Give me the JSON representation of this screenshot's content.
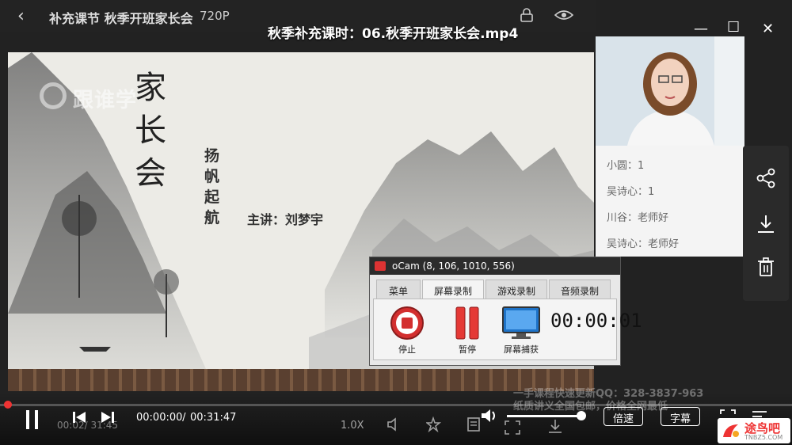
{
  "player": {
    "back_icon": "chevron-left-icon",
    "lesson_title": "补充课节 秋季开班家长会",
    "quality": "720P",
    "window_title": "秋季补充课时：06.秋季开班家长会.mp4",
    "logo_text": "跟谁学"
  },
  "slide": {
    "title_chars": [
      "家",
      "长",
      "会"
    ],
    "subtitle_chars": [
      "扬",
      "帆",
      "起",
      "航"
    ],
    "speaker": "主讲：刘梦宇"
  },
  "chat": {
    "messages": [
      {
        "text": "小圆：1"
      },
      {
        "text": "吴诗心：1"
      },
      {
        "text": "川谷：老师好"
      },
      {
        "text": "吴诗心：老师好"
      }
    ]
  },
  "ocam": {
    "title": "oCam (8, 106, 1010, 556)",
    "tabs": [
      "菜单",
      "屏幕录制",
      "游戏录制",
      "音频录制"
    ],
    "active_tab": 1,
    "buttons": {
      "stop": "停止",
      "pause": "暂停",
      "capture": "屏幕捕获"
    },
    "timer": "00:00:01"
  },
  "controls": {
    "current_time": "00:00:00",
    "time_sep": " / ",
    "total_time": "00:31:47",
    "bg_time": "00:02/ 31:45",
    "speed": "1.0X",
    "speed_btn": "倍速",
    "subtitle_btn": "字幕",
    "progress": 0.0
  },
  "watermark": {
    "line1": "一手课程快速更新QQ：328-3837-963",
    "line2": "纸质讲义全国包邮，价格全网最低"
  },
  "brand": {
    "text": "途鸟吧",
    "sub": "TNBZ5.COM"
  },
  "colors": {
    "accent": "#e33333",
    "ocam_stop": "#d32f2f",
    "ocam_pause": "#e53935",
    "ocam_capture": "#1e73c8"
  }
}
